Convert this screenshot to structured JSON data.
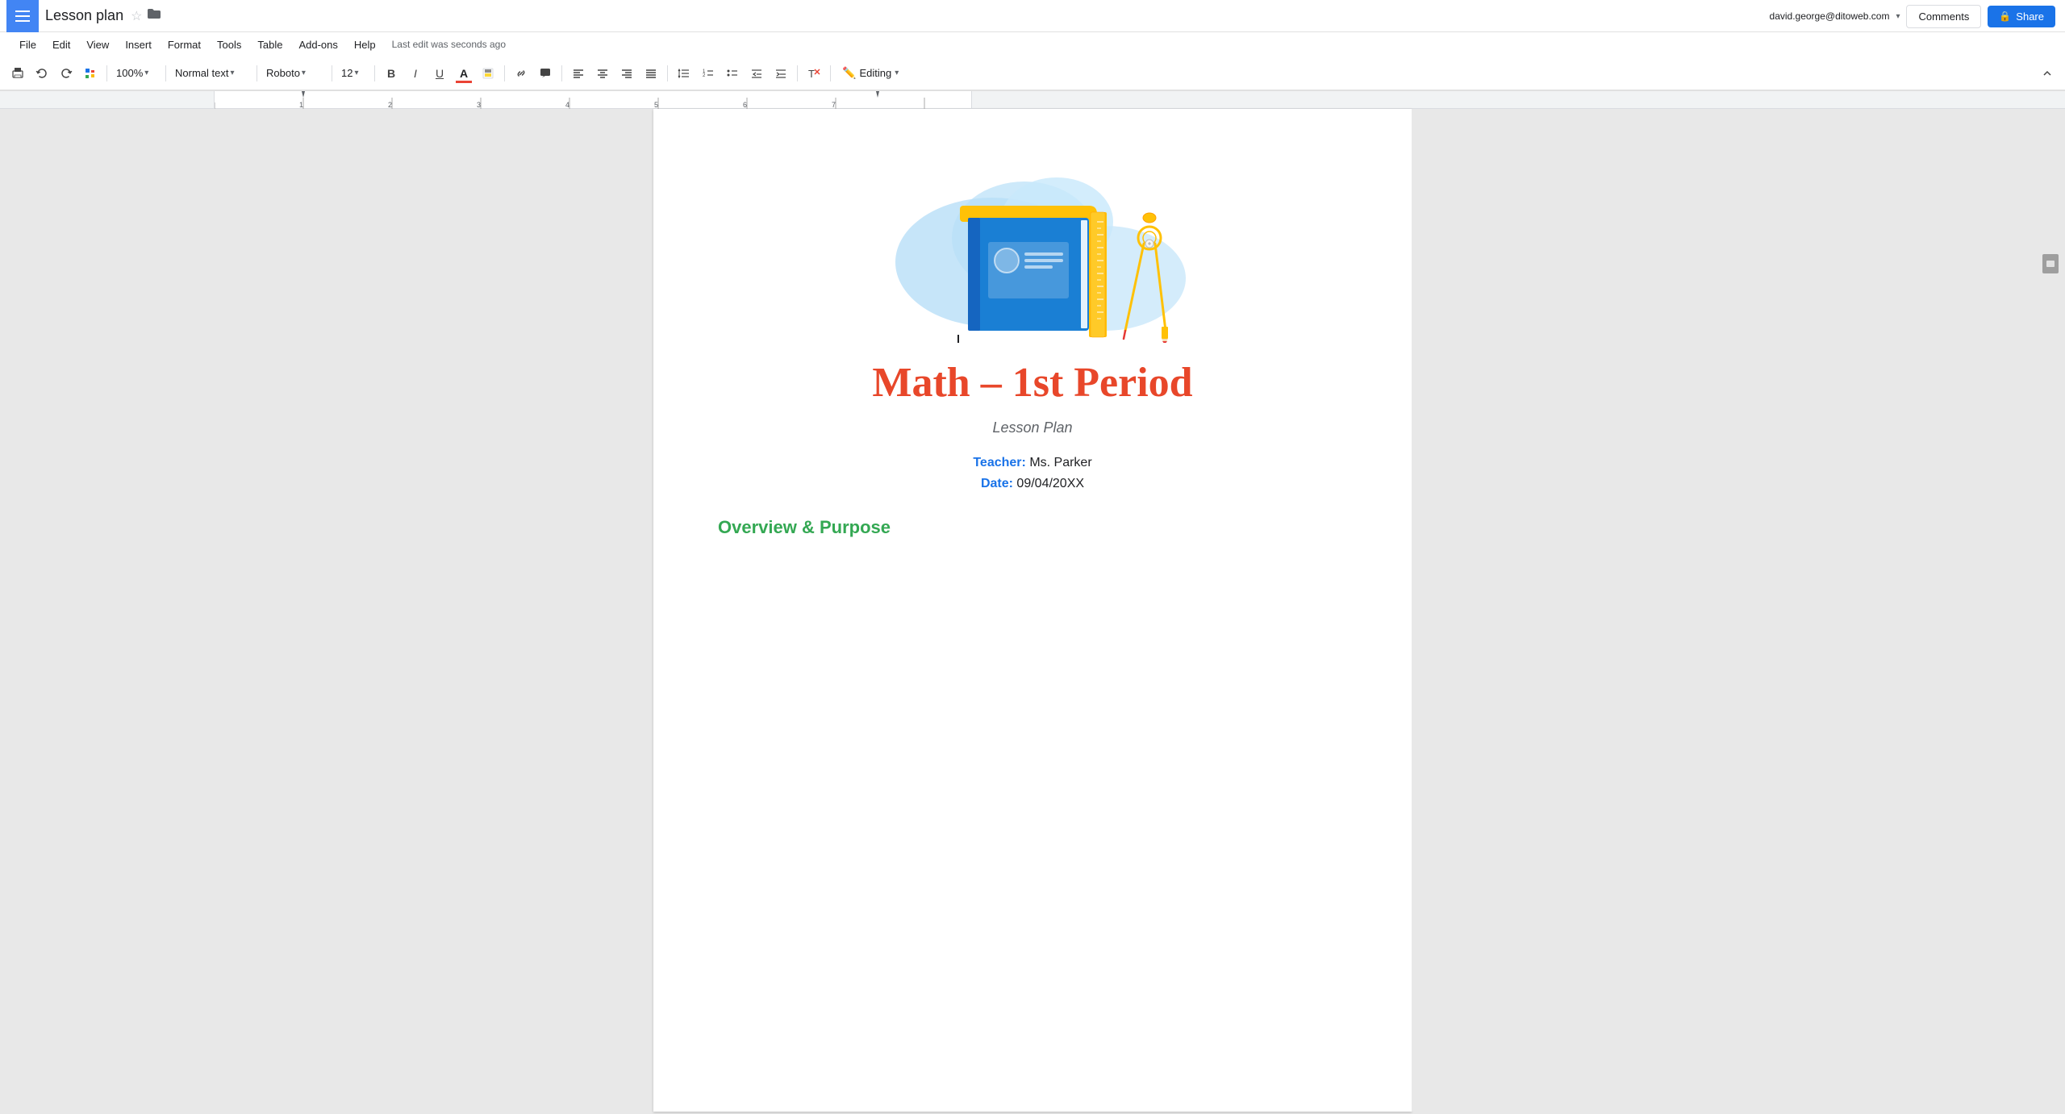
{
  "app": {
    "hamburger_label": "☰",
    "doc_title": "Lesson plan",
    "star_icon": "☆",
    "folder_icon": "📁"
  },
  "menu": {
    "file": "File",
    "edit": "Edit",
    "view": "View",
    "insert": "Insert",
    "format": "Format",
    "tools": "Tools",
    "table": "Table",
    "addons": "Add-ons",
    "help": "Help",
    "last_edit": "Last edit was seconds ago"
  },
  "top_right": {
    "user_email": "david.george@ditoweb.com",
    "comments_label": "Comments",
    "share_label": "Share"
  },
  "toolbar": {
    "print": "🖨",
    "undo": "↩",
    "redo": "↪",
    "paint": "🖌",
    "zoom": "100%",
    "style": "Normal text",
    "font": "Roboto",
    "size": "12",
    "bold": "B",
    "italic": "I",
    "underline": "U",
    "text_color": "A",
    "highlight": "▐",
    "link": "🔗",
    "comment": "💬",
    "align_left": "≡",
    "align_center": "≡",
    "align_right": "≡",
    "align_justify": "≡",
    "line_spacing": "↕",
    "numbered_list": "1≡",
    "bulleted_list": "•≡",
    "indent_less": "⇤",
    "indent_more": "⇥",
    "clear_format": "T̲",
    "editing_mode": "Editing",
    "pencil_icon": "✎",
    "collapse": "⌃"
  },
  "document": {
    "title": "Math – 1st Period",
    "subtitle": "Lesson Plan",
    "teacher_label": "Teacher:",
    "teacher_value": "Ms. Parker",
    "date_label": "Date:",
    "date_value": "09/04/20XX",
    "section_heading": "Overview & Purpose"
  },
  "illustration": {
    "cloud_color": "#b8dff8",
    "book_color": "#1a7fd4",
    "book_dark": "#1565c0",
    "book_cover_color": "#ffc107",
    "ruler_color": "#ffc107",
    "compass_color": "#ffc107",
    "compass_needle": "#e53935"
  }
}
